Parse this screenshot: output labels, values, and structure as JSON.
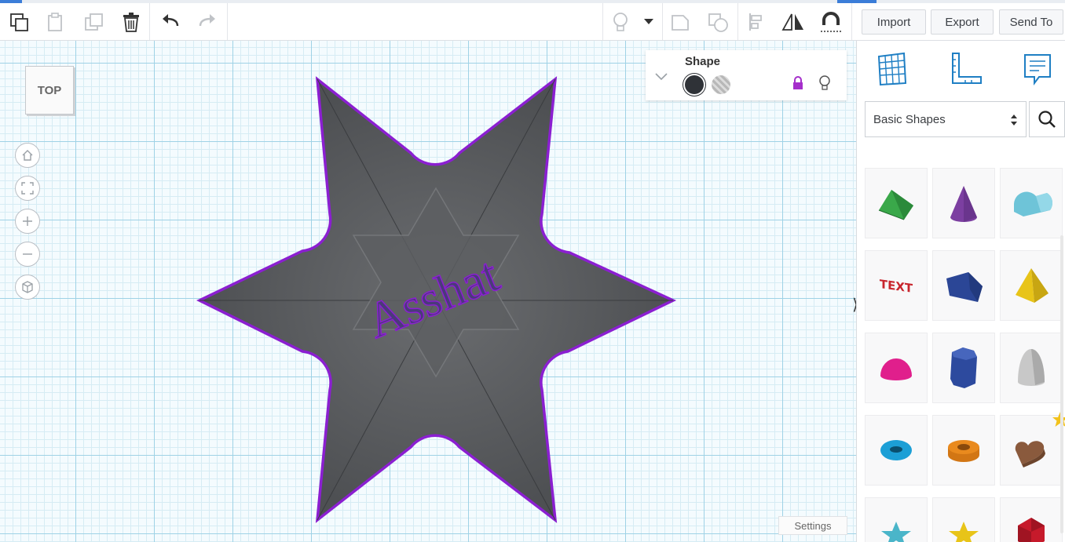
{
  "app": "Tinkercad",
  "toolbar": {
    "import_label": "Import",
    "export_label": "Export",
    "send_to_label": "Send To"
  },
  "viewcube": {
    "face_label": "TOP"
  },
  "inspector": {
    "title": "Shape",
    "solid_color": "#2f3237",
    "hole_color": "#b8b8b8",
    "lock_color": "#a52fcb"
  },
  "canvas": {
    "shape_text": "Asshat",
    "shape_color": "#555759",
    "outline_color": "#8b1fd1"
  },
  "sidebar": {
    "category_selected": "Basic Shapes",
    "shapes": [
      {
        "name": "roof",
        "color": "#3aa84a"
      },
      {
        "name": "cone",
        "color": "#7c3fa1"
      },
      {
        "name": "round-roof",
        "color": "#6ec4d8"
      },
      {
        "name": "text",
        "color": "#c8252d"
      },
      {
        "name": "polygon",
        "color": "#2b4696"
      },
      {
        "name": "pyramid",
        "color": "#e8c418"
      },
      {
        "name": "half-sphere",
        "color": "#e01f8c"
      },
      {
        "name": "hexagonal-prism",
        "color": "#2d4a9e"
      },
      {
        "name": "paraboloid",
        "color": "#c8c8c8"
      },
      {
        "name": "torus",
        "color": "#1c9fd6"
      },
      {
        "name": "tube",
        "color": "#e98a1e"
      },
      {
        "name": "heart",
        "color": "#8a5a3d"
      },
      {
        "name": "star",
        "color": "#4ab5c9"
      },
      {
        "name": "star-yellow",
        "color": "#e8c418"
      },
      {
        "name": "icosahedron",
        "color": "#c61a2b"
      }
    ]
  },
  "footer": {
    "settings_label": "Settings"
  }
}
